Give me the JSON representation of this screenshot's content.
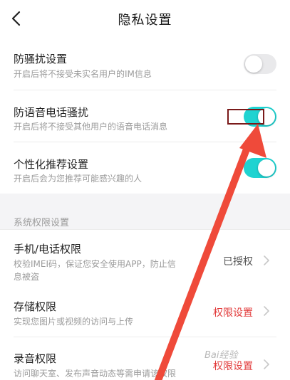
{
  "header": {
    "title": "隐私设置",
    "back_icon": "chevron-left-icon"
  },
  "settings": [
    {
      "title": "防骚扰设置",
      "desc": "开启后将不接受未实名用户的IM信息",
      "enabled": false
    },
    {
      "title": "防语音电话骚扰",
      "desc": "开启后将不接受其他用户的语音电话消息",
      "enabled": true
    },
    {
      "title": "个性化推荐设置",
      "desc": "开启后会为您推荐可能感兴趣的人",
      "enabled": true
    }
  ],
  "section": {
    "label": "系统权限设置"
  },
  "permissions": [
    {
      "title": "手机/电话权限",
      "desc_line1": "校验IMEI码，保证您安全使用APP，防止信",
      "desc_line2": "息被盗",
      "status": "已授权",
      "status_color": "#555555"
    },
    {
      "title": "存储权限",
      "desc_line1": "实现您图片或视频的访问与上传",
      "status": "权限设置",
      "status_color": "#e23b3b"
    },
    {
      "title": "录音权限",
      "desc_line1": "访问聊天室、发布声音动态等需申请该权限",
      "status": "权限设置",
      "status_color": "#e23b3b"
    }
  ],
  "colors": {
    "toggle_on": "#1fd3d1",
    "toggle_off": "#e9e9eb",
    "arrow": "#ef4a3a",
    "highlight_box": "#7a1a1a"
  },
  "watermark": "Bai经验"
}
